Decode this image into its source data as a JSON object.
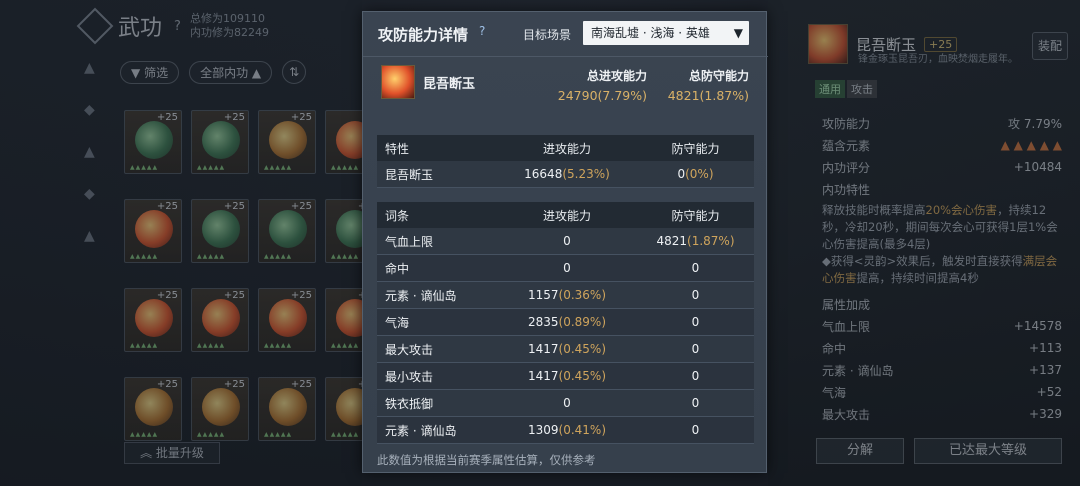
{
  "left": {
    "title": "武功",
    "help": "?",
    "total_cultivation": "总修为109110",
    "inner_cultivation": "内功修为82249",
    "filter_label": "筛选",
    "all_inner_label": "全部内功",
    "sort_icon": "sort-icon",
    "batch_upgrade": "批量升级",
    "grid_cells": [
      {
        "orb": "green",
        "lvl": "+25"
      },
      {
        "orb": "green",
        "lvl": "+25"
      },
      {
        "orb": "gold",
        "lvl": "+25"
      },
      {
        "orb": "fire",
        "lvl": ""
      },
      {
        "orb": "fire",
        "lvl": "+25"
      },
      {
        "orb": "green",
        "lvl": "+25"
      },
      {
        "orb": "green",
        "lvl": "+25"
      },
      {
        "orb": "green",
        "lvl": "+25"
      },
      {
        "orb": "fire",
        "lvl": "+25"
      },
      {
        "orb": "fire",
        "lvl": "+25"
      },
      {
        "orb": "fire",
        "lvl": "+25"
      },
      {
        "orb": "fire",
        "lvl": "+25"
      },
      {
        "orb": "gold",
        "lvl": "+25"
      },
      {
        "orb": "gold",
        "lvl": "+25"
      },
      {
        "orb": "gold",
        "lvl": "+25"
      },
      {
        "orb": "gold",
        "lvl": "+25"
      }
    ]
  },
  "modal": {
    "title": "攻防能力详情",
    "help": "?",
    "scene_label": "目标场景",
    "scene_value": "南海乱墟 · 浅海 · 英雄",
    "scene_arrow": "▼",
    "item_name": "昆吾断玉",
    "total_attack_label": "总进攻能力",
    "total_attack_value": "24790(7.79%)",
    "total_defense_label": "总防守能力",
    "total_defense_value": "4821(1.87%)",
    "trait_table": {
      "headers": [
        "特性",
        "进攻能力",
        "防守能力"
      ],
      "rows": [
        {
          "name": "昆吾断玉",
          "atk": "16648",
          "atk_pct": "(5.23%)",
          "def": "0",
          "def_pct": "(0%)"
        }
      ]
    },
    "entry_table": {
      "headers": [
        "词条",
        "进攻能力",
        "防守能力"
      ],
      "rows": [
        {
          "name": "气血上限",
          "atk": "0",
          "atk_pct": "",
          "def": "4821",
          "def_pct": "(1.87%)"
        },
        {
          "name": "命中",
          "atk": "0",
          "atk_pct": "",
          "def": "0",
          "def_pct": ""
        },
        {
          "name": "元素 · 谪仙岛",
          "atk": "1157",
          "atk_pct": "(0.36%)",
          "def": "0",
          "def_pct": ""
        },
        {
          "name": "气海",
          "atk": "2835",
          "atk_pct": "(0.89%)",
          "def": "0",
          "def_pct": ""
        },
        {
          "name": "最大攻击",
          "atk": "1417",
          "atk_pct": "(0.45%)",
          "def": "0",
          "def_pct": ""
        },
        {
          "name": "最小攻击",
          "atk": "1417",
          "atk_pct": "(0.45%)",
          "def": "0",
          "def_pct": ""
        },
        {
          "name": "铁衣抵御",
          "atk": "0",
          "atk_pct": "",
          "def": "0",
          "def_pct": ""
        },
        {
          "name": "元素 · 谪仙岛",
          "atk": "1309",
          "atk_pct": "(0.41%)",
          "def": "0",
          "def_pct": ""
        }
      ]
    },
    "footer": "此数值为根据当前赛季属性估算，仅供参考"
  },
  "right": {
    "name": "昆吾断玉",
    "plus": "+25",
    "desc": "锋金琢玉昆吾刃，血映焚烟走履年。",
    "equip": "装配",
    "tag_active": "通用",
    "tag_other": "攻击",
    "attack_label": "攻防能力",
    "attack_badge": "攻",
    "attack_value": "7.79%",
    "elements_label": "蕴含元素",
    "score_label": "内功评分",
    "score_value": "+10484",
    "trait_label": "内功特性",
    "trait_text_1": "释放技能时概率提高",
    "trait_hl_1": "20%会心伤害",
    "trait_text_2": "，持续12秒，冷却20秒，期间每次会心可获得1层1%会心伤害提高(最多4层)",
    "trait_text_3": "◆获得<灵韵>效果后，触发时直接获得",
    "trait_hl_2": "满层会心伤害",
    "trait_text_4": "提高，持续时间提高4秒",
    "bonus_label": "属性加成",
    "bonus_rows": [
      {
        "name": "气血上限",
        "value": "+14578"
      },
      {
        "name": "命中",
        "value": "+113"
      },
      {
        "name": "元素 · 谪仙岛",
        "value": "+137"
      },
      {
        "name": "气海",
        "value": "+52"
      },
      {
        "name": "最大攻击",
        "value": "+329"
      }
    ],
    "decompose": "分解",
    "max_level": "已达最大等级"
  }
}
